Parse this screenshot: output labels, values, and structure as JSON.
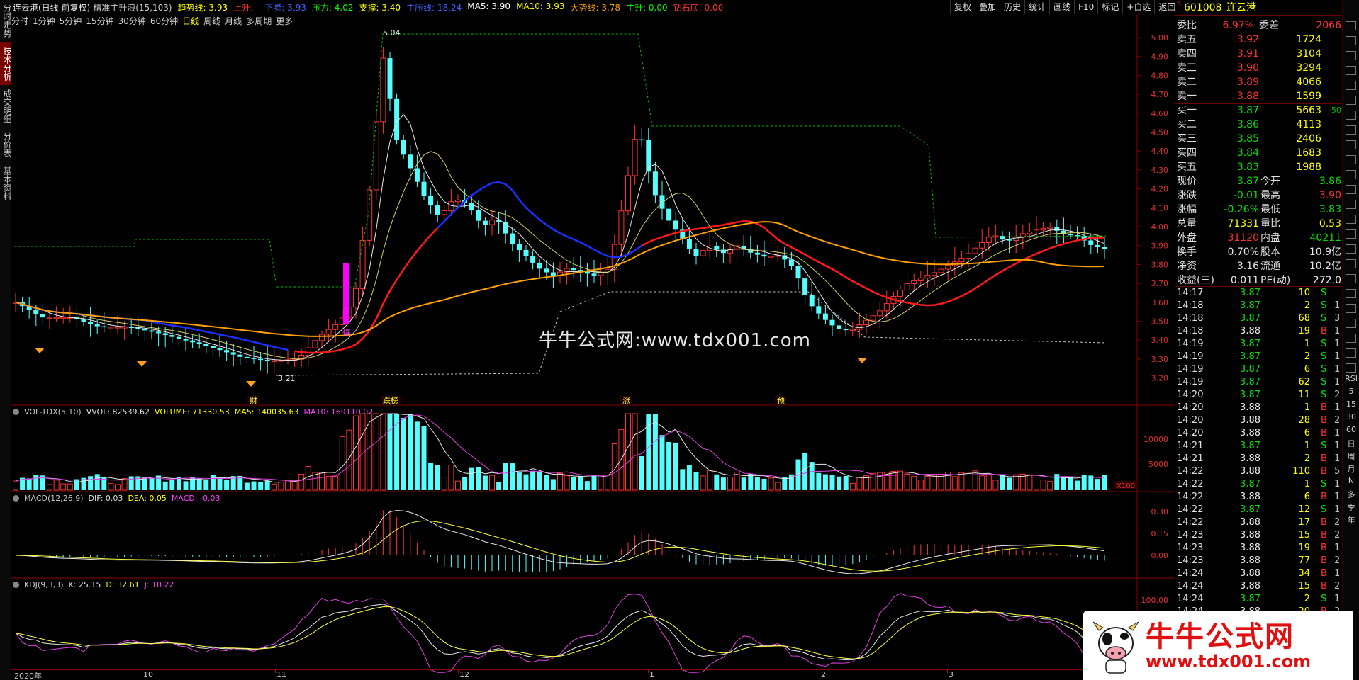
{
  "left_tabs": [
    "分时走势",
    "技术分析",
    "成交明细",
    "分价表",
    "基本资料"
  ],
  "header": {
    "title": "连云港(日线 前复权)",
    "formula_name": "精准主升浪(15,103)",
    "indicators": [
      {
        "label": "趋势线: 3.93",
        "color": "#ffff00"
      },
      {
        "label": "上升: -",
        "color": "#ff3030"
      },
      {
        "label": "下降: 3.93",
        "color": "#4060ff"
      },
      {
        "label": "压力: 4.02",
        "color": "#00ff00"
      },
      {
        "label": "支撑: 3.40",
        "color": "#ffff00"
      },
      {
        "label": "主压线: 18.24",
        "color": "#4060ff"
      },
      {
        "label": "MA5: 3.90",
        "color": "#ffffff"
      },
      {
        "label": "MA10: 3.93",
        "color": "#ffff00"
      },
      {
        "label": "大势线: 3.78",
        "color": "#ffa000"
      },
      {
        "label": "主升: 0.00",
        "color": "#00ff00"
      },
      {
        "label": "钻石底: 0.00",
        "color": "#ff3030"
      }
    ]
  },
  "toolbar": [
    "复权",
    "叠加",
    "历史",
    "统计",
    "画线",
    "F10",
    "标记",
    "+自选",
    "返回"
  ],
  "periods": [
    "分时",
    "1分钟",
    "5分钟",
    "15分钟",
    "30分钟",
    "60分钟",
    "日线",
    "周线",
    "月线",
    "多周期",
    "更多"
  ],
  "active_period": "日线",
  "main_chart": {
    "y_ticks": [
      "5.00",
      "4.90",
      "4.80",
      "4.70",
      "4.60",
      "4.50",
      "4.40",
      "4.30",
      "4.20",
      "4.10",
      "4.00",
      "3.90",
      "3.80",
      "3.70",
      "3.60",
      "3.50",
      "3.40",
      "3.30",
      "3.20"
    ],
    "high_label": "5.04",
    "low_label": "3.21",
    "event_labels": [
      "财",
      "跌榜",
      "涨",
      "预"
    ],
    "blast_label": "爆"
  },
  "watermark": "牛牛公式网:www.tdx001.com",
  "vol_panel": {
    "labels": [
      {
        "text": "VOL-TDX(5,10)",
        "color": "#c8c8c8"
      },
      {
        "text": "VVOL: 82539.62",
        "color": "#e0e0e0"
      },
      {
        "text": "VOLUME: 71330.53",
        "color": "#ffff00"
      },
      {
        "text": "MA5: 140035.63",
        "color": "#ffff00"
      },
      {
        "text": "MA10: 169110.02",
        "color": "#ff40ff"
      }
    ],
    "y_ticks": [
      "10000",
      "5000"
    ],
    "unit": "X100"
  },
  "macd_panel": {
    "labels": [
      {
        "text": "MACD(12,26,9)",
        "color": "#c8c8c8"
      },
      {
        "text": "DIF: 0.03",
        "color": "#e0e0e0"
      },
      {
        "text": "DEA: 0.05",
        "color": "#ffff00"
      },
      {
        "text": "MACD: -0.03",
        "color": "#ff40ff"
      }
    ],
    "y_ticks": [
      "0.30",
      "0.15",
      "0.00"
    ]
  },
  "kdj_panel": {
    "labels": [
      {
        "text": "KDJ(9,3,3)",
        "color": "#c8c8c8"
      },
      {
        "text": "K: 25.15",
        "color": "#e0e0e0"
      },
      {
        "text": "D: 32.61",
        "color": "#ffff00"
      },
      {
        "text": "J: 10.22",
        "color": "#ff40ff"
      }
    ],
    "y_ticks": [
      "100.00"
    ]
  },
  "x_axis": [
    "2020年",
    "10",
    "11",
    "12",
    "1",
    "2",
    "3"
  ],
  "quote": {
    "code": "601008",
    "name": "连云港",
    "r_badge": "R",
    "wei_bi_label": "委比",
    "wei_bi": "6.97%",
    "wei_cha_label": "委差",
    "wei_cha": "2066",
    "asks": [
      {
        "label": "卖五",
        "price": "3.92",
        "vol": "1724",
        "chg": ""
      },
      {
        "label": "卖四",
        "price": "3.91",
        "vol": "3104",
        "chg": ""
      },
      {
        "label": "卖三",
        "price": "3.90",
        "vol": "3294",
        "chg": ""
      },
      {
        "label": "卖二",
        "price": "3.89",
        "vol": "4066",
        "chg": ""
      },
      {
        "label": "卖一",
        "price": "3.88",
        "vol": "1599",
        "chg": ""
      }
    ],
    "bids": [
      {
        "label": "买一",
        "price": "3.87",
        "vol": "5663",
        "chg": "-50"
      },
      {
        "label": "买二",
        "price": "3.86",
        "vol": "4113",
        "chg": ""
      },
      {
        "label": "买三",
        "price": "3.85",
        "vol": "2406",
        "chg": ""
      },
      {
        "label": "买四",
        "price": "3.84",
        "vol": "1683",
        "chg": ""
      },
      {
        "label": "买五",
        "price": "3.83",
        "vol": "1988",
        "chg": ""
      }
    ],
    "info": [
      {
        "l1": "现价",
        "v1": "3.87",
        "c1": "green",
        "l2": "今开",
        "v2": "3.86",
        "c2": "green"
      },
      {
        "l1": "涨跌",
        "v1": "-0.01",
        "c1": "green",
        "l2": "最高",
        "v2": "3.90",
        "c2": "red"
      },
      {
        "l1": "涨幅",
        "v1": "-0.26%",
        "c1": "green",
        "l2": "最低",
        "v2": "3.83",
        "c2": "green"
      },
      {
        "l1": "总量",
        "v1": "71331",
        "c1": "yellow",
        "l2": "量比",
        "v2": "0.53",
        "c2": "yellow"
      },
      {
        "l1": "外盘",
        "v1": "31120",
        "c1": "red",
        "l2": "内盘",
        "v2": "40211",
        "c2": "green"
      },
      {
        "l1": "换手",
        "v1": "0.70%",
        "c1": "white",
        "l2": "股本",
        "v2": "10.9亿",
        "c2": "white"
      },
      {
        "l1": "净资",
        "v1": "3.16",
        "c1": "white",
        "l2": "流通",
        "v2": "10.2亿",
        "c2": "white"
      },
      {
        "l1": "收益(三)",
        "v1": "0.011",
        "c1": "white",
        "l2": "PE(动)",
        "v2": "272.0",
        "c2": "white"
      }
    ],
    "ticks": [
      {
        "t": "14:17",
        "p": "3.87",
        "v": "10",
        "f": "S",
        "n": ""
      },
      {
        "t": "14:18",
        "p": "3.87",
        "v": "2",
        "f": "S",
        "n": "1"
      },
      {
        "t": "14:18",
        "p": "3.87",
        "v": "68",
        "f": "S",
        "n": "3"
      },
      {
        "t": "14:18",
        "p": "3.88",
        "v": "19",
        "f": "B",
        "n": "1"
      },
      {
        "t": "14:19",
        "p": "3.87",
        "v": "1",
        "f": "S",
        "n": "1"
      },
      {
        "t": "14:19",
        "p": "3.87",
        "v": "2",
        "f": "S",
        "n": "1"
      },
      {
        "t": "14:19",
        "p": "3.87",
        "v": "6",
        "f": "S",
        "n": "1"
      },
      {
        "t": "14:19",
        "p": "3.87",
        "v": "62",
        "S": "",
        "f": "S",
        "n": "1"
      },
      {
        "t": "14:20",
        "p": "3.87",
        "v": "11",
        "f": "S",
        "n": "2"
      },
      {
        "t": "14:20",
        "p": "3.88",
        "v": "1",
        "f": "B",
        "n": "1"
      },
      {
        "t": "14:20",
        "p": "3.88",
        "v": "28",
        "f": "B",
        "n": "2"
      },
      {
        "t": "14:20",
        "p": "3.88",
        "v": "6",
        "f": "B",
        "n": "1"
      },
      {
        "t": "14:21",
        "p": "3.87",
        "v": "1",
        "f": "S",
        "n": "1"
      },
      {
        "t": "14:21",
        "p": "3.88",
        "v": "2",
        "f": "B",
        "n": "1"
      },
      {
        "t": "14:22",
        "p": "3.88",
        "v": "110",
        "f": "B",
        "n": "5"
      },
      {
        "t": "14:22",
        "p": "3.87",
        "v": "1",
        "f": "S",
        "n": "1"
      },
      {
        "t": "14:22",
        "p": "3.88",
        "v": "6",
        "f": "B",
        "n": "1"
      },
      {
        "t": "14:22",
        "p": "3.87",
        "v": "12",
        "f": "S",
        "n": "1"
      },
      {
        "t": "14:22",
        "p": "3.88",
        "v": "17",
        "f": "B",
        "n": "2"
      },
      {
        "t": "14:23",
        "p": "3.88",
        "v": "15",
        "f": "B",
        "n": "2"
      },
      {
        "t": "14:23",
        "p": "3.88",
        "v": "19",
        "f": "B",
        "n": "1"
      },
      {
        "t": "14:23",
        "p": "3.88",
        "v": "77",
        "f": "B",
        "n": "2"
      },
      {
        "t": "14:24",
        "p": "3.88",
        "v": "34",
        "f": "B",
        "n": "1"
      },
      {
        "t": "14:24",
        "p": "3.88",
        "v": "15",
        "f": "B",
        "n": "2"
      },
      {
        "t": "14:24",
        "p": "3.87",
        "v": "2",
        "f": "S",
        "n": "1"
      },
      {
        "t": "14:24",
        "p": "3.88",
        "v": "20",
        "f": "B",
        "n": "2"
      }
    ]
  },
  "right_tools": [
    "RSI",
    "5",
    "15",
    "30",
    "60",
    "日",
    "周",
    "月",
    "N",
    "多",
    "季",
    "年"
  ],
  "logo": {
    "line1": "牛牛公式网",
    "line2": "www.tdx001.com"
  }
}
